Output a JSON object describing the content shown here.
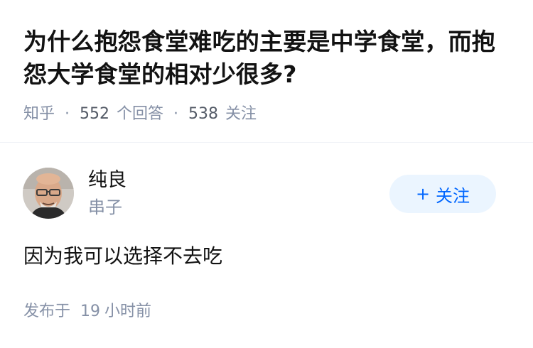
{
  "question": {
    "title": "为什么抱怨食堂难吃的主要是中学食堂，而抱怨大学食堂的相对少很多?",
    "source": "知乎",
    "answer_count": "552",
    "answer_label": "个回答",
    "follow_count": "538",
    "follow_label": "关注"
  },
  "author": {
    "name": "纯良",
    "bio": "串子",
    "follow_button_label": "关注",
    "follow_button_icon": "plus-icon"
  },
  "answer": {
    "content": "因为我可以选择不去吃",
    "published_prefix": "发布于",
    "published_value": "19",
    "published_suffix": "小时前"
  },
  "colors": {
    "title": "#121212",
    "meta": "#8590a6",
    "accent": "#0066ff",
    "button_bg": "#ebf5ff"
  }
}
